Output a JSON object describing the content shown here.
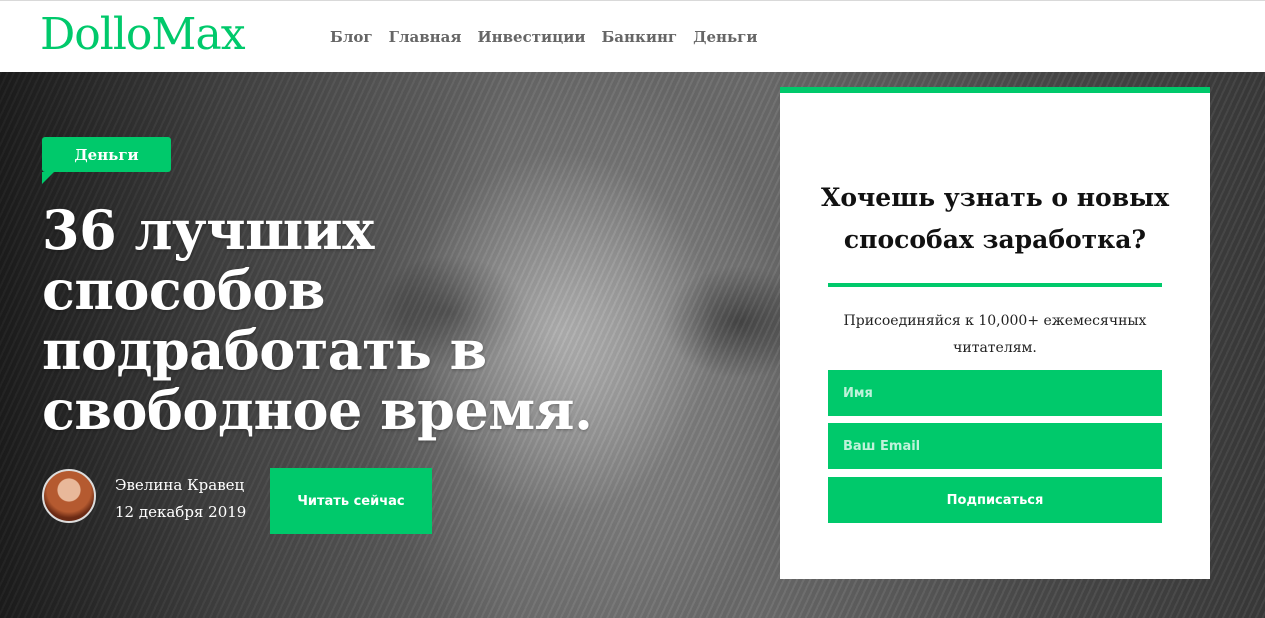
{
  "brand": {
    "logo": "DolloMax",
    "accent_color": "#00c96b"
  },
  "nav": {
    "items": [
      {
        "label": "Блог"
      },
      {
        "label": "Главная"
      },
      {
        "label": "Инвестиции"
      },
      {
        "label": "Банкинг"
      },
      {
        "label": "Деньги"
      }
    ]
  },
  "hero": {
    "category": "Деньги",
    "title": "36 лучших способов подработать в свободное время.",
    "author": {
      "name": "Эвелина Кравец",
      "date": "12 декабря 2019"
    },
    "read_button": "Читать сейчас"
  },
  "subscribe": {
    "title": "Хочешь узнать о новых способах заработка?",
    "subtitle": "Присоединяйся к 10,000+ ежемесячных читателям.",
    "name_placeholder": "Имя",
    "email_placeholder": "Ваш Email",
    "button": "Подписаться"
  }
}
